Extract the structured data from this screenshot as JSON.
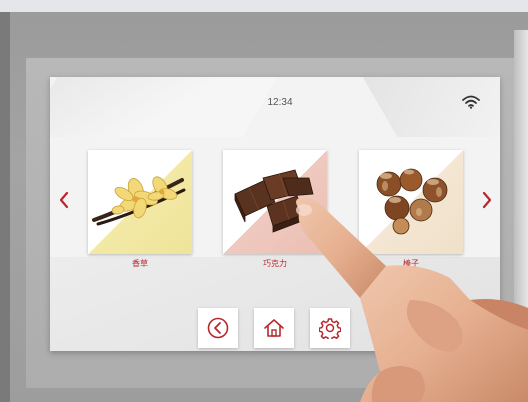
{
  "status": {
    "time": "12:34"
  },
  "flavors": [
    {
      "label": "香草",
      "icon": "vanilla-flower-icon"
    },
    {
      "label": "巧克力",
      "icon": "chocolate-pieces-icon"
    },
    {
      "label": "榛子",
      "icon": "hazelnut-icon"
    }
  ],
  "nav": {
    "back_icon": "back-circle-icon",
    "home_icon": "home-icon",
    "settings_icon": "gear-icon"
  },
  "colors": {
    "accent": "#b7282e",
    "screen_bg": "#f3f3f3"
  }
}
